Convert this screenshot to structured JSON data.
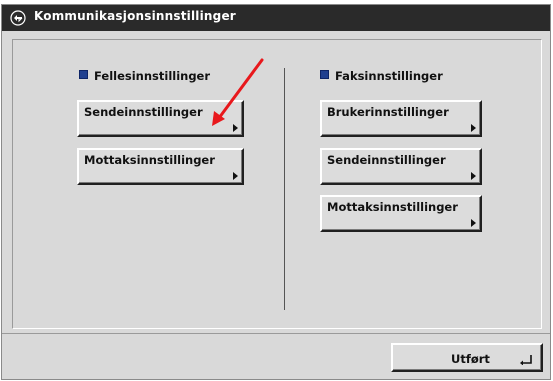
{
  "window": {
    "title": "Kommunikasjonsinnstillinger",
    "logo_icon": "network-settings-icon"
  },
  "left_section": {
    "header": "Fellesinnstillinger",
    "buttons": [
      {
        "label": "Sendeinnstillinger"
      },
      {
        "label": "Mottaksinnstillinger"
      }
    ]
  },
  "right_section": {
    "header": "Faksinnstillinger",
    "buttons": [
      {
        "label": "Brukerinnstillinger"
      },
      {
        "label": "Sendeinnstillinger"
      },
      {
        "label": "Mottaksinnstillinger"
      }
    ]
  },
  "footer": {
    "done_label": "Utført",
    "done_icon": "enter-return-icon"
  },
  "annotation": {
    "icon": "red-pointer-arrow",
    "color": "#e8181c"
  },
  "colors": {
    "title_bar": "#2a2a2a",
    "panel_bg": "#d9d9d9",
    "bullet": "#1f3f8f"
  }
}
